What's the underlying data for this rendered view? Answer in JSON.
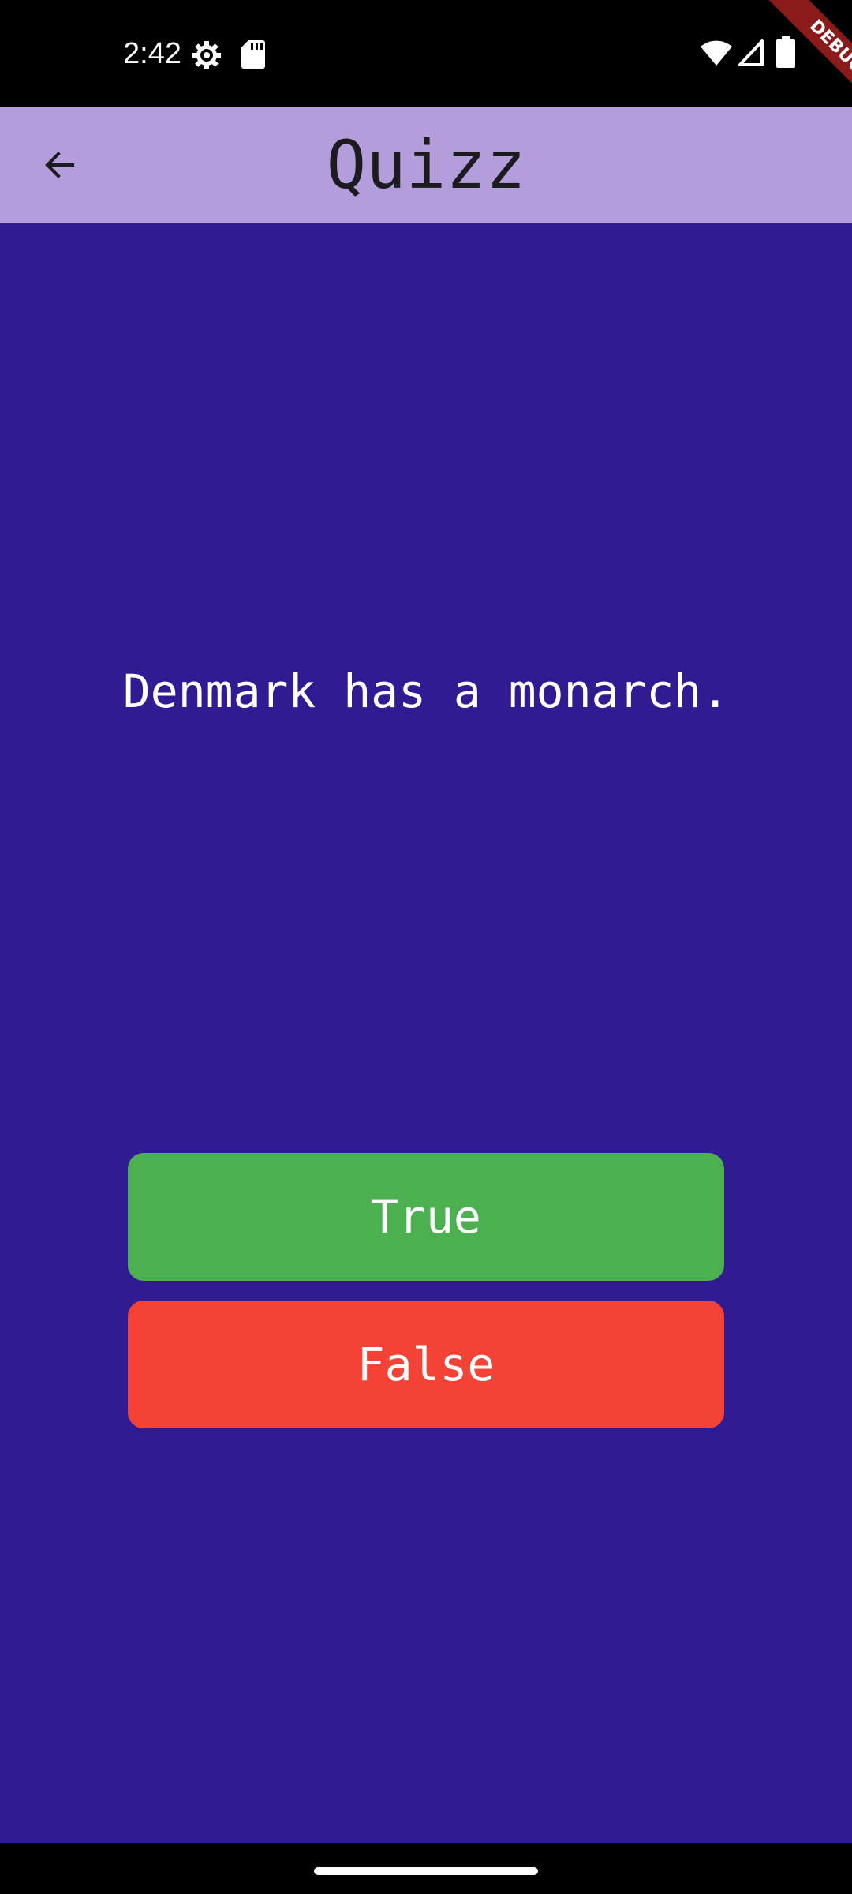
{
  "status_bar": {
    "time": "2:42",
    "icons": [
      "settings-icon",
      "sd-card-icon",
      "wifi-icon",
      "signal-icon",
      "battery-icon"
    ],
    "debug_label": "DEBUG"
  },
  "app_bar": {
    "title": "Quizz",
    "back_icon": "arrow-back-icon",
    "background": "#B39DDB"
  },
  "quiz": {
    "question": "Denmark has a monarch.",
    "true_label": "True",
    "false_label": "False",
    "colors": {
      "background": "#311B92",
      "true": "#4CAF50",
      "false": "#F44336"
    }
  }
}
